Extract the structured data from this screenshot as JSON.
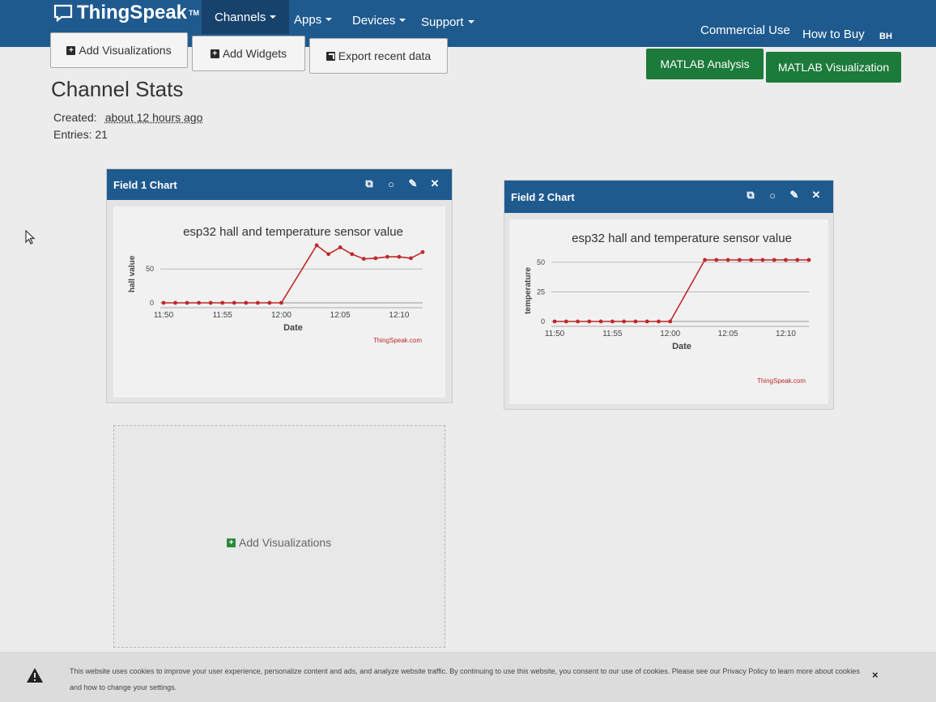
{
  "navbar": {
    "brand": "ThingSpeak",
    "brand_tm": "TM",
    "items": [
      "Channels",
      "Apps",
      "Devices",
      "Support"
    ],
    "right_items": [
      "Commercial Use",
      "How to Buy"
    ],
    "avatar": "BH"
  },
  "toolbar": {
    "add_visualizations": "Add Visualizations",
    "add_widgets": "Add Widgets",
    "export": "Export recent data",
    "matlab_analysis": "MATLAB Analysis",
    "matlab_visualization": "MATLAB Visualization"
  },
  "stats": {
    "title": "Channel Stats",
    "created_label": "Created:",
    "created_value": "about 12 hours ago",
    "entries_label": "Entries:",
    "entries_value": "21"
  },
  "charts": [
    {
      "header": "Field 1 Chart",
      "brandmark": "ThingSpeak.com"
    },
    {
      "header": "Field 2 Chart",
      "brandmark": "ThingSpeak.com"
    }
  ],
  "chart_data": [
    {
      "type": "line",
      "title": "esp32 hall and temperature sensor value",
      "xlabel": "Date",
      "ylabel": "hall value",
      "x_ticks": [
        "11:50",
        "11:55",
        "12:00",
        "12:05",
        "12:10"
      ],
      "y_ticks": [
        0,
        50
      ],
      "ylim": [
        0,
        85
      ],
      "x": [
        "11:50",
        "11:51",
        "11:52",
        "11:53",
        "11:54",
        "11:55",
        "11:56",
        "11:57",
        "11:58",
        "11:59",
        "12:00",
        "12:03",
        "12:04",
        "12:05",
        "12:06",
        "12:07",
        "12:08",
        "12:09",
        "12:10",
        "12:11",
        "12:12"
      ],
      "values": [
        0,
        0,
        0,
        0,
        0,
        0,
        0,
        0,
        0,
        0,
        0,
        85,
        72,
        82,
        72,
        65,
        66,
        68,
        68,
        66,
        75
      ],
      "color": "#c0282a"
    },
    {
      "type": "line",
      "title": "esp32 hall and temperature sensor value",
      "xlabel": "Date",
      "ylabel": "temperature",
      "x_ticks": [
        "11:50",
        "11:55",
        "12:00",
        "12:05",
        "12:10"
      ],
      "y_ticks": [
        0,
        25,
        50
      ],
      "ylim": [
        0,
        52
      ],
      "x": [
        "11:50",
        "11:51",
        "11:52",
        "11:53",
        "11:54",
        "11:55",
        "11:56",
        "11:57",
        "11:58",
        "11:59",
        "12:00",
        "12:03",
        "12:04",
        "12:05",
        "12:06",
        "12:07",
        "12:08",
        "12:09",
        "12:10",
        "12:11",
        "12:12"
      ],
      "values": [
        0,
        0,
        0,
        0,
        0,
        0,
        0,
        0,
        0,
        0,
        0,
        52,
        52,
        52,
        52,
        52,
        52,
        52,
        52,
        52,
        52
      ],
      "color": "#c0282a"
    }
  ],
  "dropzone": {
    "label": "Add Visualizations"
  },
  "cookie": {
    "text": "This website uses cookies to improve your user experience, personalize content and ads, and analyze website traffic. By continuing to use this website, you consent to our use of cookies. Please see our Privacy Policy to learn more about cookies and how to change your settings.",
    "close": "×"
  }
}
